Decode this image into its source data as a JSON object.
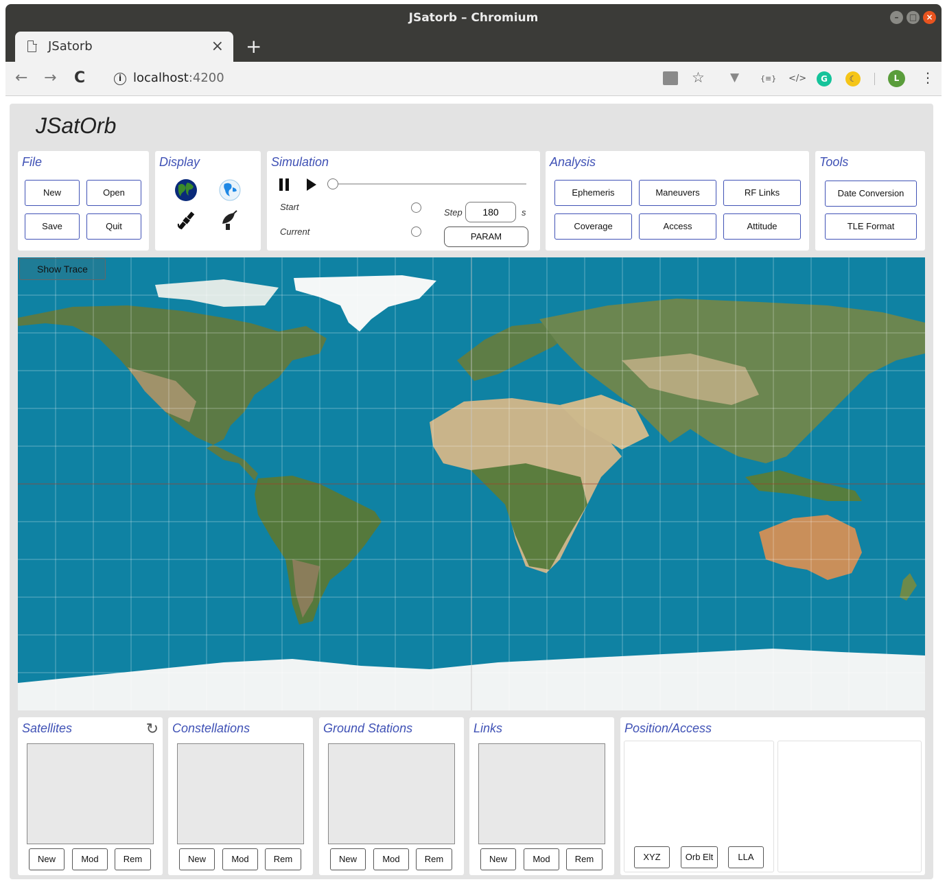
{
  "window": {
    "title": "JSatorb – Chromium"
  },
  "tab": {
    "title": "JSatorb",
    "close": "×",
    "new_tab": "+"
  },
  "address_bar": {
    "host": "localhost",
    "port": ":4200"
  },
  "extensions": {
    "vue": "▼",
    "json": "{≡}",
    "code": "</>",
    "grammarly": "G",
    "profile": "L",
    "menu": "⋮",
    "star": "☆"
  },
  "app": {
    "title": "JSatOrb"
  },
  "file": {
    "title": "File",
    "new": "New",
    "open": "Open",
    "save": "Save",
    "quit": "Quit"
  },
  "display": {
    "title": "Display"
  },
  "simulation": {
    "title": "Simulation",
    "start_label": "Start",
    "current_label": "Current",
    "step_label": "Step",
    "step_value": "180",
    "step_unit": "s",
    "param": "PARAM",
    "progress": 0
  },
  "analysis": {
    "title": "Analysis",
    "ephemeris": "Ephemeris",
    "maneuvers": "Maneuvers",
    "rf_links": "RF Links",
    "coverage": "Coverage",
    "access": "Access",
    "attitude": "Attitude"
  },
  "tools": {
    "title": "Tools",
    "date_conversion": "Date Conversion",
    "tle_format": "TLE Format"
  },
  "map": {
    "show_trace": "Show Trace"
  },
  "satellites": {
    "title": "Satellites",
    "new": "New",
    "mod": "Mod",
    "rem": "Rem"
  },
  "constellations": {
    "title": "Constellations",
    "new": "New",
    "mod": "Mod",
    "rem": "Rem"
  },
  "ground_stations": {
    "title": "Ground Stations",
    "new": "New",
    "mod": "Mod",
    "rem": "Rem"
  },
  "links": {
    "title": "Links",
    "new": "New",
    "mod": "Mod",
    "rem": "Rem"
  },
  "position_access": {
    "title": "Position/Access",
    "xyz": "XYZ",
    "orb_elt": "Orb Elt",
    "lla": "LLA"
  },
  "colors": {
    "accent": "#3f51b5",
    "ocean": "#0f82a3",
    "panel_bg": "#e3e3e3"
  }
}
